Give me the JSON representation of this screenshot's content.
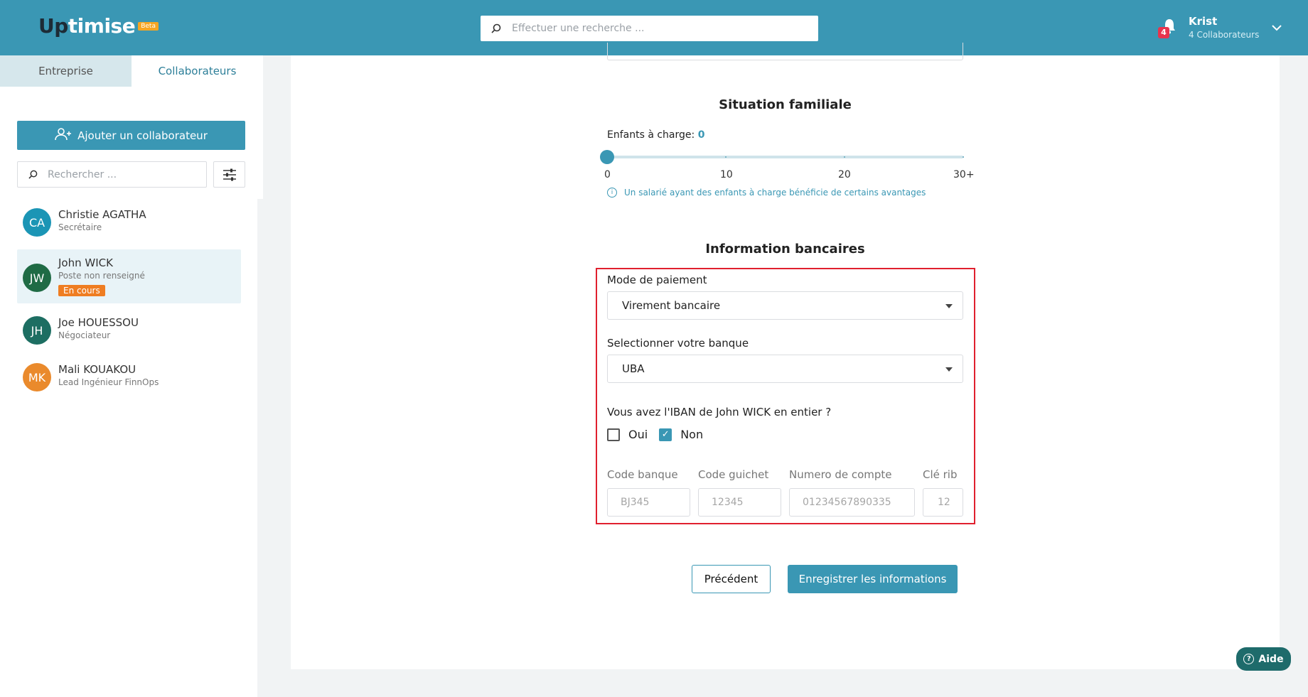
{
  "header": {
    "logo_main": "Up",
    "logo_rest": "timise",
    "logo_badge": "Beta",
    "search_placeholder": "Effectuer une recherche ...",
    "notification_count": "4",
    "user_name": "Krist",
    "user_subtitle": "4 Collaborateurs"
  },
  "sidebar": {
    "tabs": [
      {
        "label": "Entreprise",
        "active": false
      },
      {
        "label": "Collaborateurs",
        "active": true
      }
    ],
    "add_button": "Ajouter un collaborateur",
    "search_placeholder": "Rechercher ...",
    "collaborators": [
      {
        "initials": "CA",
        "name": "Christie AGATHA",
        "role": "Secrétaire",
        "color": "#1b95b5",
        "status": ""
      },
      {
        "initials": "JW",
        "name": "John WICK",
        "role": "Poste non renseigné",
        "color": "#1f6b45",
        "status": "En cours"
      },
      {
        "initials": "JH",
        "name": "Joe HOUESSOU",
        "role": "Négociateur",
        "color": "#1d6e62",
        "status": ""
      },
      {
        "initials": "MK",
        "name": "Mali KOUAKOU",
        "role": "Lead Ingénieur FinnOps",
        "color": "#ea8a2c",
        "status": ""
      }
    ]
  },
  "family": {
    "title": "Situation familiale",
    "kids_label": "Enfants à charge: ",
    "kids_value": "0",
    "ticks": [
      "0",
      "10",
      "20",
      "30+"
    ],
    "hint": "Un salarié ayant des enfants à charge bénéficie de certains avantages"
  },
  "bank": {
    "title": "Information bancaires",
    "payment_label": "Mode de paiement",
    "payment_value": "Virement bancaire",
    "bank_label": "Selectionner votre banque",
    "bank_value": "UBA",
    "iban_question": "Vous avez l'IBAN de John WICK en entier ?",
    "yes_label": "Oui",
    "no_label": "Non",
    "yes_checked": false,
    "no_checked": true,
    "fields": {
      "code_banque_label": "Code banque",
      "code_banque_placeholder": "BJ345",
      "code_guichet_label": "Code guichet",
      "code_guichet_placeholder": "12345",
      "numero_compte_label": "Numero de compte",
      "numero_compte_placeholder": "01234567890335",
      "cle_rib_label": "Clé rib",
      "cle_rib_placeholder": "12"
    }
  },
  "actions": {
    "prev": "Précédent",
    "save": "Enregistrer les informations"
  },
  "help": {
    "label": "Aide"
  },
  "colors": {
    "primary": "#3a97b4",
    "highlight": "#e0202e",
    "status_badge": "#ef7d22",
    "notification": "#e8344e"
  }
}
